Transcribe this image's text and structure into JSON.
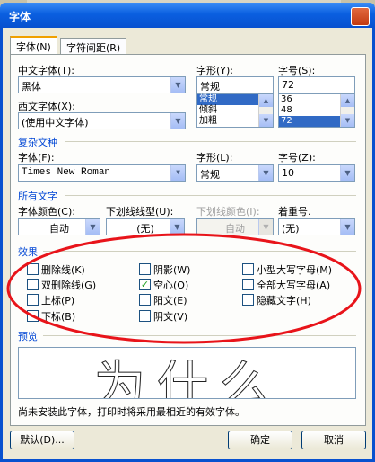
{
  "window": {
    "title": "字体",
    "close_glyph": "✕"
  },
  "tabs": [
    {
      "label": "字体(N)"
    },
    {
      "label": "字符间距(R)"
    }
  ],
  "chinese_font": {
    "label": "中文字体(T):",
    "value": "黑体"
  },
  "font_style": {
    "label": "字形(Y):",
    "value": "常规",
    "options": [
      "常规",
      "倾斜",
      "加粗"
    ]
  },
  "font_size": {
    "label": "字号(S):",
    "value": "72",
    "options": [
      "36",
      "48",
      "72"
    ]
  },
  "western_font": {
    "label": "西文字体(X):",
    "value": "(使用中文字体)"
  },
  "complex": {
    "header": "复杂文种",
    "font_label": "字体(F):",
    "font_value": "Times New Roman",
    "style_label": "字形(L):",
    "style_value": "常规",
    "size_label": "字号(Z):",
    "size_value": "10"
  },
  "all_text": {
    "header": "所有文字",
    "color_label": "字体颜色(C):",
    "color_value": "自动",
    "underline_label": "下划线线型(U):",
    "underline_value": "(无)",
    "underline_color_label": "下划线颜色(I):",
    "underline_color_value": "自动",
    "emphasis_label": "着重号.",
    "emphasis_value": "(无)"
  },
  "effects": {
    "header": "效果",
    "items": [
      {
        "label": "删除线(K)",
        "checked": false
      },
      {
        "label": "阴影(W)",
        "checked": false
      },
      {
        "label": "小型大写字母(M)",
        "checked": false
      },
      {
        "label": "双删除线(G)",
        "checked": false
      },
      {
        "label": "空心(O)",
        "checked": true
      },
      {
        "label": "全部大写字母(A)",
        "checked": false
      },
      {
        "label": "上标(P)",
        "checked": false
      },
      {
        "label": "阳文(E)",
        "checked": false
      },
      {
        "label": "隐藏文字(H)",
        "checked": false
      },
      {
        "label": "下标(B)",
        "checked": false
      },
      {
        "label": "阴文(V)",
        "checked": false
      }
    ]
  },
  "preview": {
    "header": "预览",
    "text": "为什么"
  },
  "note": "尚未安装此字体，打印时将采用最相近的有效字体。",
  "buttons": {
    "default": "默认(D)...",
    "ok": "确定",
    "cancel": "取消"
  },
  "icons": {
    "dropdown": "▼",
    "scroll_up": "▲",
    "scroll_down": "▼",
    "check": "✓"
  },
  "annotation_color": "#e8141a",
  "accent_color": "#0851cf"
}
